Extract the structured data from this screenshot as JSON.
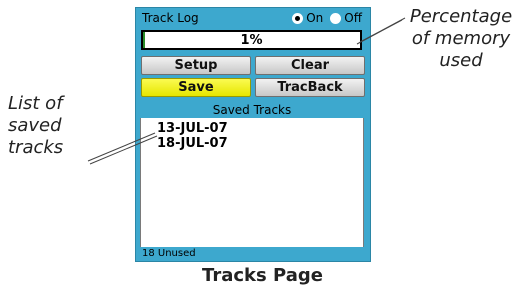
{
  "header": {
    "title": "Track Log",
    "radio_on": "On",
    "radio_off": "Off",
    "selected": "On"
  },
  "memory": {
    "percent_text": "1%",
    "percent": 1
  },
  "buttons": {
    "setup": "Setup",
    "clear": "Clear",
    "save": "Save",
    "tracback": "TracBack"
  },
  "saved_tracks": {
    "header": "Saved Tracks",
    "items": [
      "13-JUL-07",
      "18-JUL-07"
    ],
    "unused": "18 Unused"
  },
  "callouts": {
    "memory": [
      "Percentage",
      "of memory",
      "used"
    ],
    "list": [
      "List of",
      "saved",
      "tracks"
    ]
  },
  "caption": "Tracks Page",
  "colors": {
    "screen": "#3da8ce",
    "save_highlight": "#ecec00"
  }
}
